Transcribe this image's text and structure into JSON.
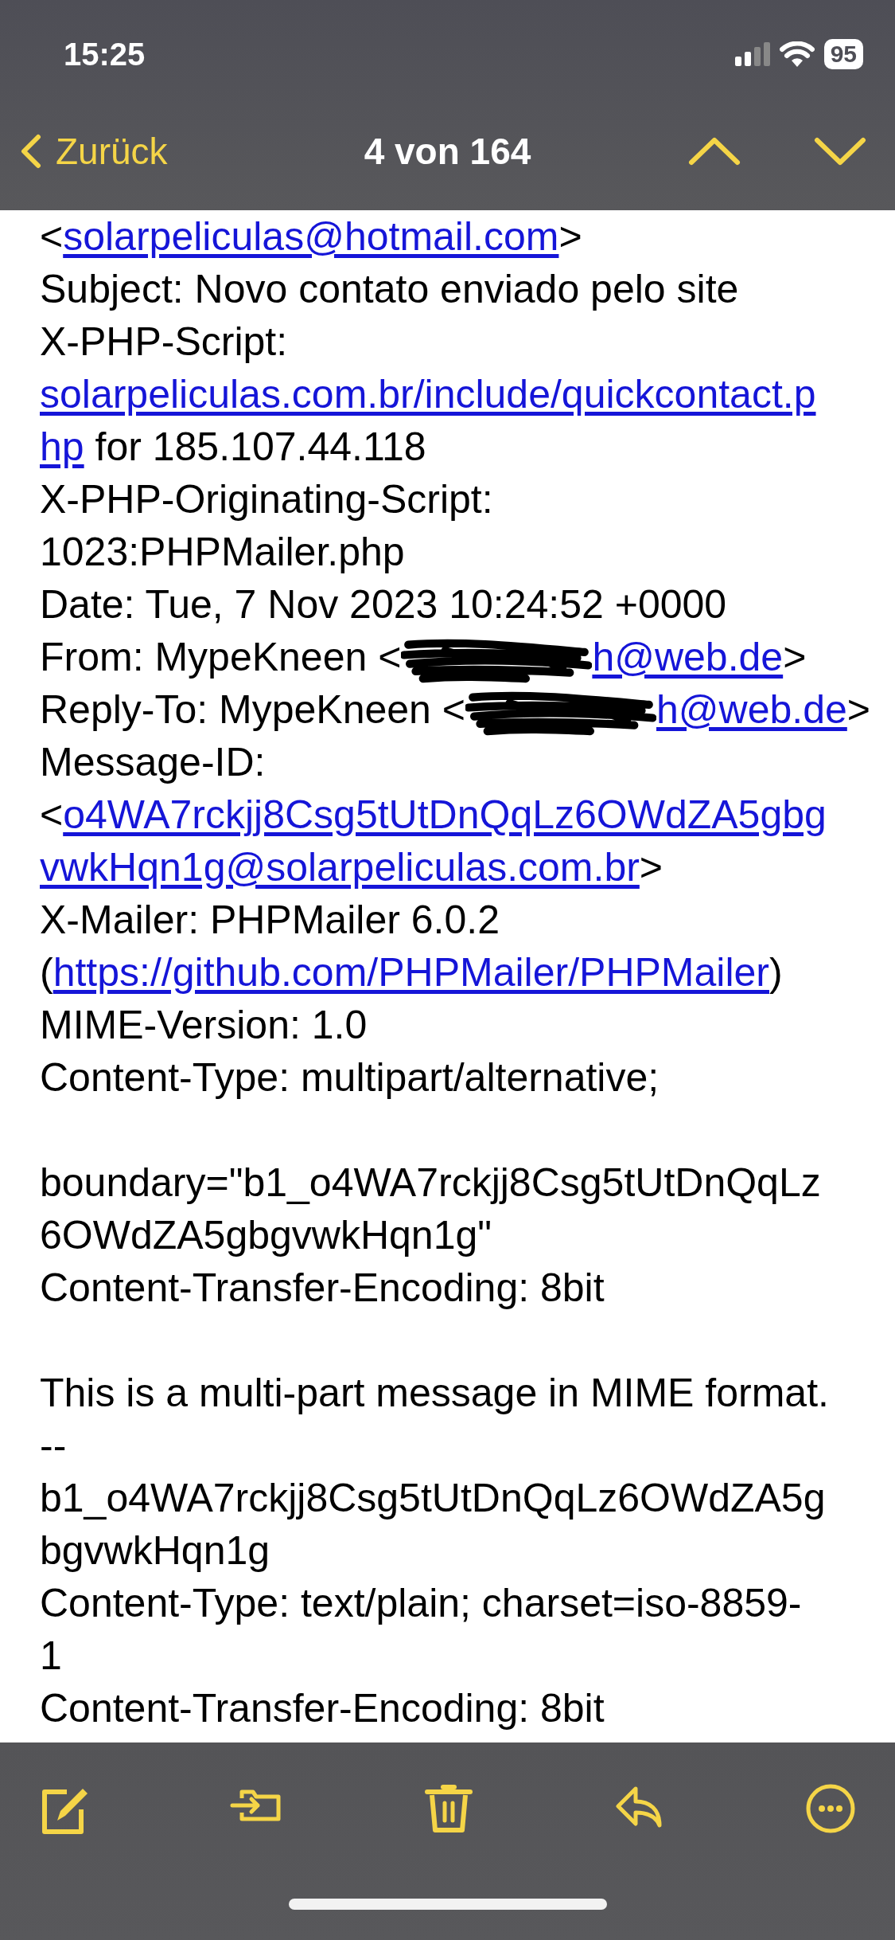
{
  "status_bar": {
    "time": "15:25",
    "battery": "95"
  },
  "nav": {
    "back": "Zurück",
    "title": "4 von 164"
  },
  "lines": [
    {
      "segments": [
        {
          "kind": "text",
          "text": "<"
        },
        {
          "kind": "link",
          "text": "solarpeliculas@hotmail.com"
        },
        {
          "kind": "text",
          "text": ">"
        }
      ]
    },
    {
      "segments": [
        {
          "kind": "text",
          "text": "Subject: Novo contato enviado pelo site"
        }
      ]
    },
    {
      "segments": [
        {
          "kind": "text",
          "text": "X-PHP-Script:"
        }
      ]
    },
    {
      "segments": [
        {
          "kind": "link",
          "text": "solarpeliculas.com.br/include/quickcontact.p"
        }
      ]
    },
    {
      "segments": [
        {
          "kind": "link",
          "text": "hp"
        },
        {
          "kind": "text",
          "text": " for 185.107.44.118"
        }
      ]
    },
    {
      "segments": [
        {
          "kind": "text",
          "text": "X-PHP-Originating-Script:"
        }
      ]
    },
    {
      "segments": [
        {
          "kind": "text",
          "text": "1023:PHPMailer.php"
        }
      ]
    },
    {
      "segments": [
        {
          "kind": "text",
          "text": "Date: Tue, 7 Nov 2023 10:24:52 +0000"
        }
      ]
    },
    {
      "segments": [
        {
          "kind": "text",
          "text": "From: MypeKneen <"
        },
        {
          "kind": "redacted"
        },
        {
          "kind": "link",
          "text": "h@web.de"
        },
        {
          "kind": "text",
          "text": ">"
        }
      ]
    },
    {
      "segments": [
        {
          "kind": "text",
          "text": "Reply-To: MypeKneen <"
        },
        {
          "kind": "redacted"
        },
        {
          "kind": "link",
          "text": "h@web.de"
        },
        {
          "kind": "text",
          "text": ">"
        }
      ]
    },
    {
      "segments": [
        {
          "kind": "text",
          "text": "Message-ID:"
        }
      ]
    },
    {
      "segments": [
        {
          "kind": "text",
          "text": "<"
        },
        {
          "kind": "link",
          "text": "o4WA7rckjj8Csg5tUtDnQqLz6OWdZA5gbg"
        }
      ]
    },
    {
      "segments": [
        {
          "kind": "link",
          "text": "vwkHqn1g@solarpeliculas.com.br"
        },
        {
          "kind": "text",
          "text": ">"
        }
      ]
    },
    {
      "segments": [
        {
          "kind": "text",
          "text": "X-Mailer: PHPMailer 6.0.2"
        }
      ]
    },
    {
      "segments": [
        {
          "kind": "text",
          "text": "("
        },
        {
          "kind": "link",
          "text": "https://github.com/PHPMailer/PHPMailer"
        },
        {
          "kind": "text",
          "text": ")"
        }
      ]
    },
    {
      "segments": [
        {
          "kind": "text",
          "text": "MIME-Version: 1.0"
        }
      ]
    },
    {
      "segments": [
        {
          "kind": "text",
          "text": "Content-Type: multipart/alternative;"
        }
      ]
    },
    {
      "space_before": true,
      "segments": [
        {
          "kind": "text",
          "text": "boundary=\"b1_o4WA7rckjj8Csg5tUtDnQqLz"
        }
      ]
    },
    {
      "segments": [
        {
          "kind": "text",
          "text": "6OWdZA5gbgvwkHqn1g\""
        }
      ]
    },
    {
      "segments": [
        {
          "kind": "text",
          "text": "Content-Transfer-Encoding: 8bit"
        }
      ]
    },
    {
      "space_before": true,
      "segments": [
        {
          "kind": "text",
          "text": "This is a multi-part message in MIME format."
        }
      ]
    },
    {
      "segments": [
        {
          "kind": "text",
          "text": "--"
        }
      ]
    },
    {
      "segments": [
        {
          "kind": "text",
          "text": "b1_o4WA7rckjj8Csg5tUtDnQqLz6OWdZA5g"
        }
      ]
    },
    {
      "segments": [
        {
          "kind": "text",
          "text": "bgvwkHqn1g"
        }
      ]
    },
    {
      "segments": [
        {
          "kind": "text",
          "text": "Content-Type: text/plain; charset=iso-8859-"
        }
      ]
    },
    {
      "segments": [
        {
          "kind": "text",
          "text": "1"
        }
      ]
    },
    {
      "segments": [
        {
          "kind": "text",
          "text": "Content-Transfer-Encoding: 8bit"
        }
      ]
    }
  ]
}
